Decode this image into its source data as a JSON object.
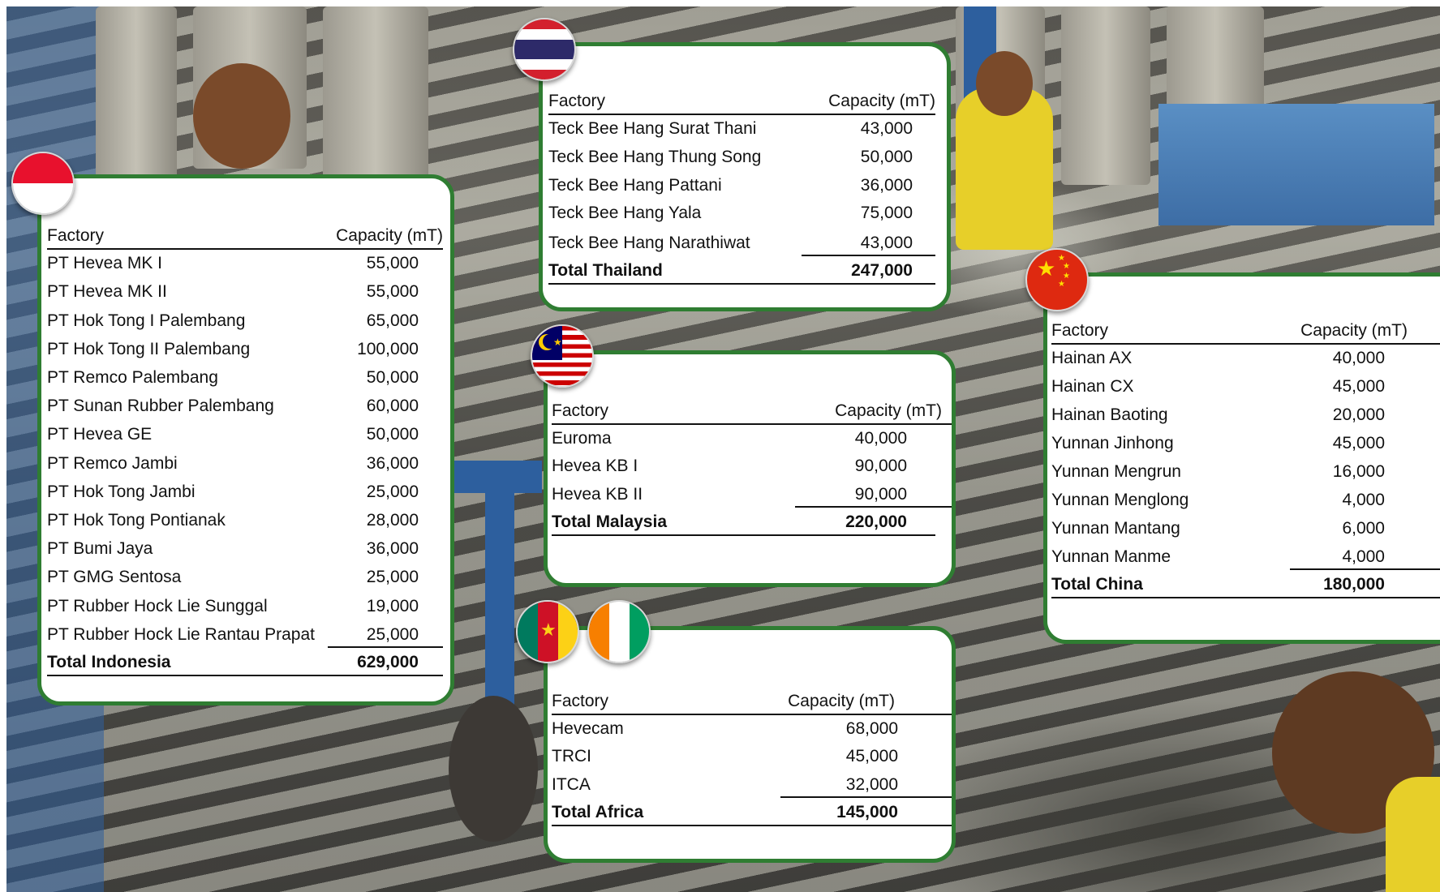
{
  "header": {
    "factory": "Factory",
    "capacity": "Capacity (mT)"
  },
  "indonesia": {
    "flag": "indonesia-flag-icon",
    "rows": [
      {
        "factory": "PT Hevea MK I",
        "capacity": "55,000"
      },
      {
        "factory": "PT Hevea MK II",
        "capacity": "55,000"
      },
      {
        "factory": "PT Hok Tong I Palembang",
        "capacity": "65,000"
      },
      {
        "factory": "PT Hok Tong II Palembang",
        "capacity": "100,000"
      },
      {
        "factory": "PT Remco Palembang",
        "capacity": "50,000"
      },
      {
        "factory": "PT Sunan Rubber Palembang",
        "capacity": "60,000"
      },
      {
        "factory": "PT Hevea GE",
        "capacity": "50,000"
      },
      {
        "factory": "PT Remco Jambi",
        "capacity": "36,000"
      },
      {
        "factory": "PT Hok Tong Jambi",
        "capacity": "25,000"
      },
      {
        "factory": "PT Hok Tong Pontianak",
        "capacity": "28,000"
      },
      {
        "factory": "PT Bumi Jaya",
        "capacity": "36,000"
      },
      {
        "factory": "PT GMG Sentosa",
        "capacity": "25,000"
      },
      {
        "factory": "PT Rubber Hock Lie Sunggal",
        "capacity": "19,000"
      },
      {
        "factory": "PT Rubber Hock Lie Rantau Prapat",
        "capacity": "25,000"
      }
    ],
    "total": {
      "factory": "Total Indonesia",
      "capacity": "629,000"
    }
  },
  "thailand": {
    "flag": "thailand-flag-icon",
    "rows": [
      {
        "factory": "Teck Bee Hang Surat Thani",
        "capacity": "43,000"
      },
      {
        "factory": "Teck Bee Hang Thung Song",
        "capacity": "50,000"
      },
      {
        "factory": "Teck Bee Hang Pattani",
        "capacity": "36,000"
      },
      {
        "factory": "Teck Bee Hang Yala",
        "capacity": "75,000"
      },
      {
        "factory": "Teck Bee Hang Narathiwat",
        "capacity": "43,000"
      }
    ],
    "total": {
      "factory": "Total Thailand",
      "capacity": "247,000"
    }
  },
  "malaysia": {
    "flag": "malaysia-flag-icon",
    "rows": [
      {
        "factory": "Euroma",
        "capacity": "40,000"
      },
      {
        "factory": "Hevea KB I",
        "capacity": "90,000"
      },
      {
        "factory": "Hevea KB II",
        "capacity": "90,000"
      }
    ],
    "total": {
      "factory": "Total Malaysia",
      "capacity": "220,000"
    }
  },
  "africa": {
    "flags": [
      "cameroon-flag-icon",
      "ivory-coast-flag-icon"
    ],
    "rows": [
      {
        "factory": "Hevecam",
        "capacity": "68,000"
      },
      {
        "factory": "TRCI",
        "capacity": "45,000"
      },
      {
        "factory": "ITCA",
        "capacity": "32,000"
      }
    ],
    "total": {
      "factory": "Total Africa",
      "capacity": "145,000"
    }
  },
  "china": {
    "flag": "china-flag-icon",
    "rows": [
      {
        "factory": "Hainan AX",
        "capacity": "40,000"
      },
      {
        "factory": "Hainan CX",
        "capacity": "45,000"
      },
      {
        "factory": "Hainan Baoting",
        "capacity": "20,000"
      },
      {
        "factory": "Yunnan Jinhong",
        "capacity": "45,000"
      },
      {
        "factory": "Yunnan Mengrun",
        "capacity": "16,000"
      },
      {
        "factory": "Yunnan Menglong",
        "capacity": "4,000"
      },
      {
        "factory": "Yunnan Mantang",
        "capacity": "6,000"
      },
      {
        "factory": "Yunnan Manme",
        "capacity": "4,000"
      }
    ],
    "total": {
      "factory": "Total China",
      "capacity": "180,000"
    }
  },
  "colors": {
    "panel_border": "#2f7d32",
    "text": "#111111"
  }
}
